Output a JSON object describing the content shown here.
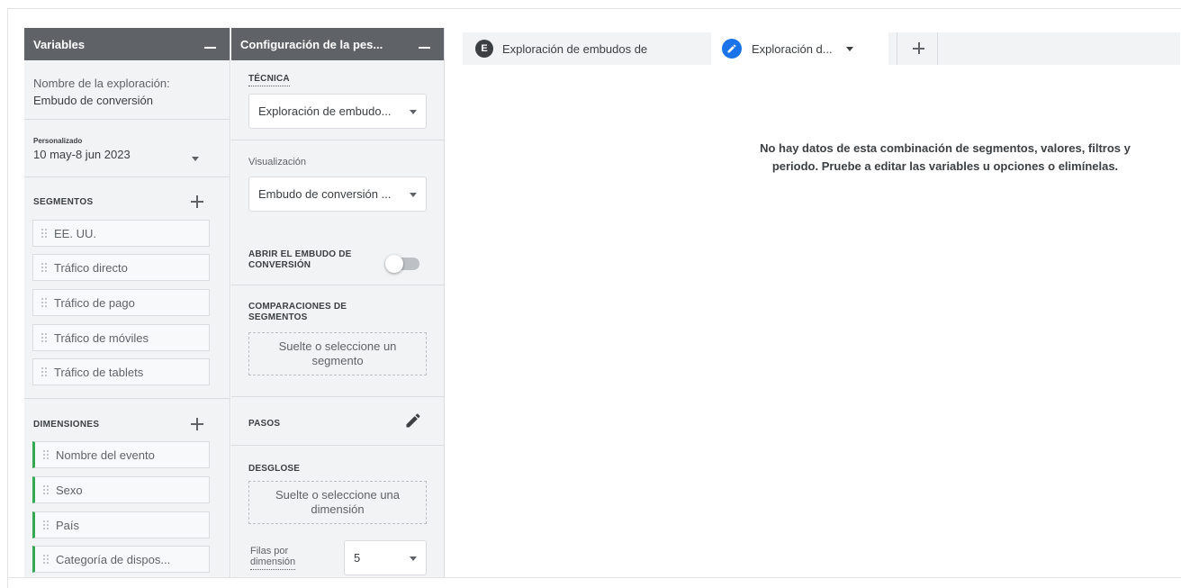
{
  "variables_panel": {
    "title": "Variables",
    "exploration_name_label": "Nombre de la exploración:",
    "exploration_name_value": "Embudo de conversión",
    "date_tag": "Personalizado",
    "date_range": "10 may-8 jun 2023",
    "segments_title": "SEGMENTOS",
    "segments": [
      "EE. UU.",
      "Tráfico directo",
      "Tráfico de pago",
      "Tráfico de móviles",
      "Tráfico de tablets"
    ],
    "dimensions_title": "DIMENSIONES",
    "dimensions": [
      "Nombre del evento",
      "Sexo",
      "País",
      "Categoría de dispos..."
    ]
  },
  "config_panel": {
    "title": "Configuración de la pes...",
    "technique_label": "TÉCNICA",
    "technique_value": "Exploración de embudo...",
    "visualization_label": "Visualización",
    "visualization_value": "Embudo de conversión ...",
    "open_funnel_line1": "ABRIR EL EMBUDO DE",
    "open_funnel_line2": "CONVERSIÓN",
    "open_funnel_on": false,
    "comparisons_line1": "COMPARACIONES DE",
    "comparisons_line2": "SEGMENTOS",
    "segment_drop_line1": "Suelte o seleccione un",
    "segment_drop_line2": "segmento",
    "steps_label": "PASOS",
    "breakdown_label": "DESGLOSE",
    "dimension_drop_line1": "Suelte o seleccione una",
    "dimension_drop_line2": "dimensión",
    "rows_label_line1": "Filas por",
    "rows_label_line2": "dimensión",
    "rows_value": "5"
  },
  "tabs": [
    {
      "badge": "E",
      "label": "Exploración de embudos de"
    },
    {
      "label": "Exploración d..."
    }
  ],
  "empty_state": {
    "line1": "No hay datos de esta combinación de segmentos, valores, filtros y",
    "line2": "periodo. Pruebe a editar las variables u opciones o elimínelas."
  },
  "colors": {
    "panel_header": "#5f6368",
    "panel_bg": "#f1f3f4",
    "dimension_accent": "#34a853",
    "edit_badge": "#1a73e8"
  }
}
